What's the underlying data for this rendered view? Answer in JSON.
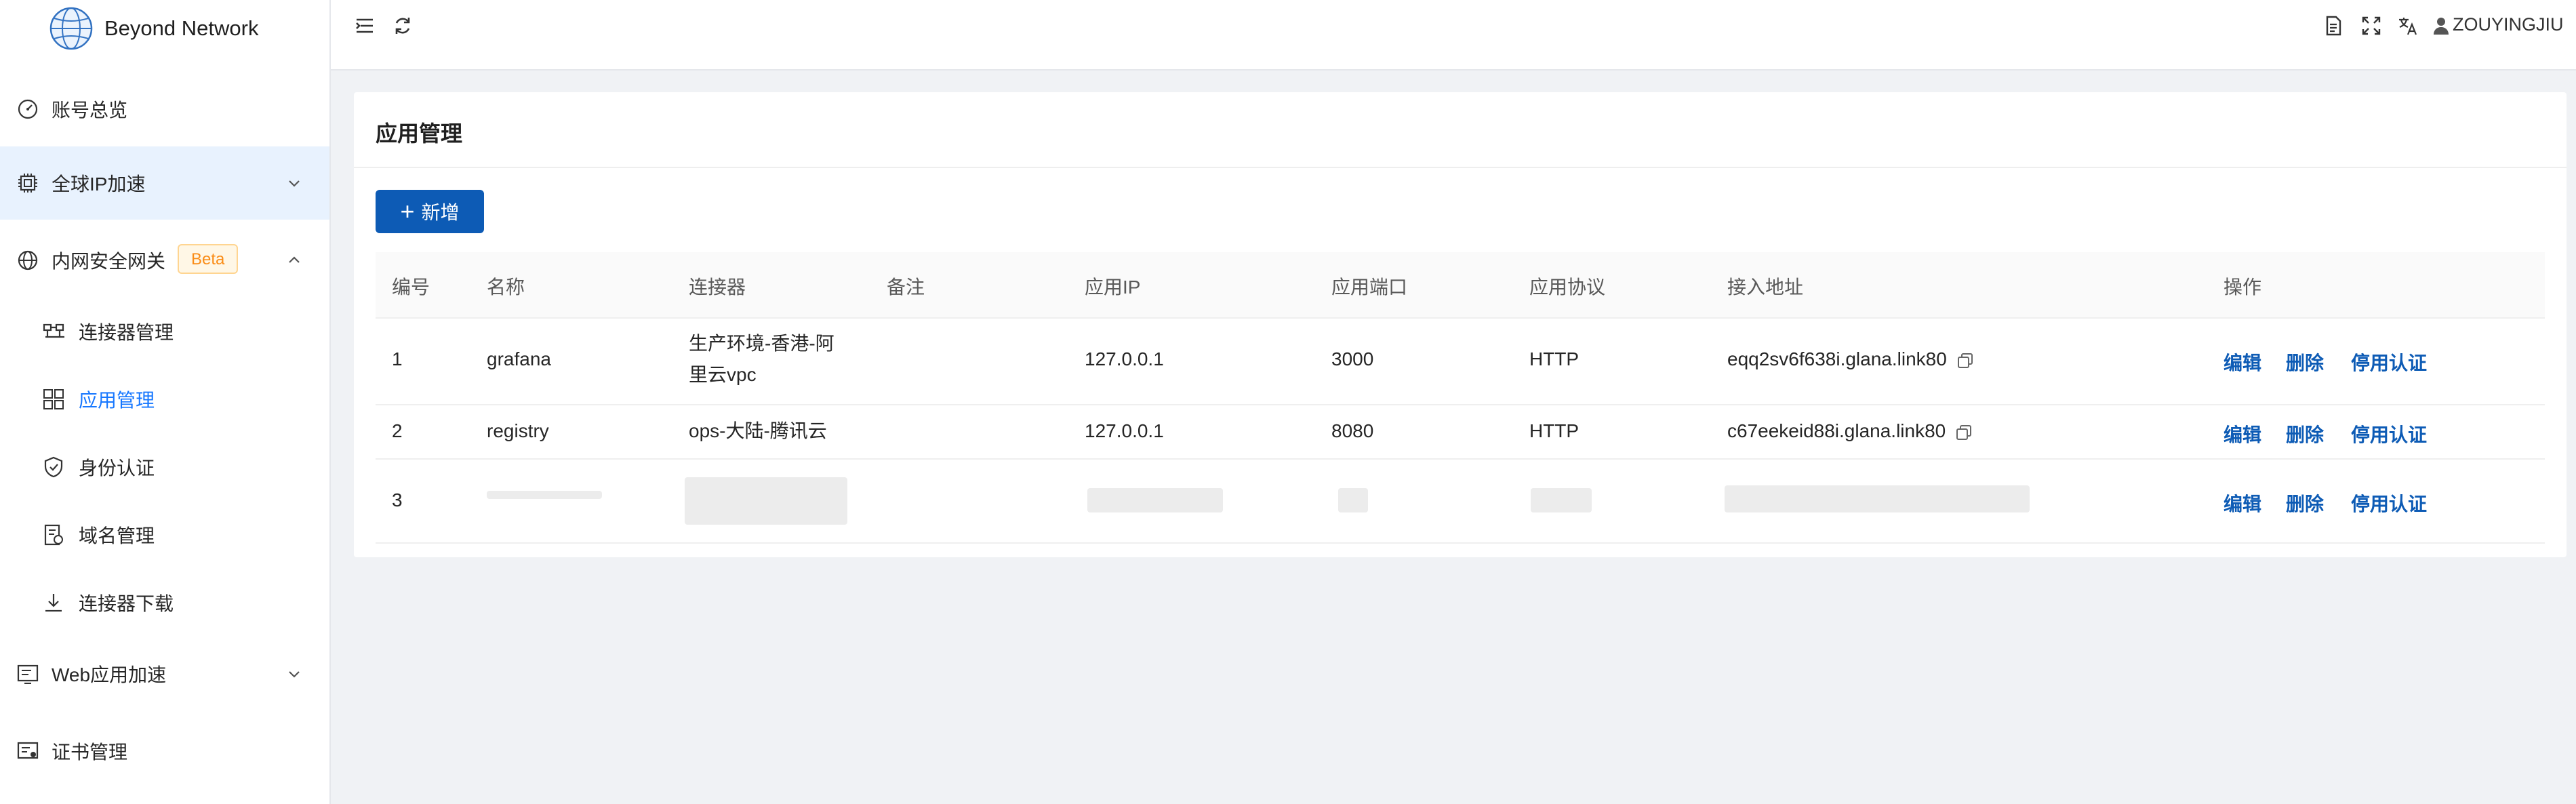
{
  "app": {
    "name": "Beyond Network"
  },
  "sidebar": {
    "items": [
      {
        "label": "账号总览",
        "icon": "dashboard-icon"
      },
      {
        "label": "全球IP加速",
        "icon": "chip-icon"
      },
      {
        "label": "内网安全网关",
        "icon": "globe-gear-icon",
        "badge": "Beta"
      },
      {
        "label": "Web应用加速",
        "icon": "web-icon"
      },
      {
        "label": "证书管理",
        "icon": "certificate-icon"
      }
    ],
    "sub_items": [
      {
        "label": "连接器管理",
        "icon": "connector-icon"
      },
      {
        "label": "应用管理",
        "icon": "apps-icon"
      },
      {
        "label": "身份认证",
        "icon": "shield-icon"
      },
      {
        "label": "域名管理",
        "icon": "domain-icon"
      },
      {
        "label": "连接器下载",
        "icon": "download-icon"
      }
    ]
  },
  "topbar": {
    "user": "ZOUYINGJIU"
  },
  "page": {
    "title": "应用管理",
    "add_label": "新增"
  },
  "table": {
    "headers": [
      "编号",
      "名称",
      "连接器",
      "备注",
      "应用IP",
      "应用端口",
      "应用协议",
      "接入地址",
      "操作"
    ],
    "rows": [
      {
        "id": "1",
        "name": "grafana",
        "connector_line1": "生产环境-香港-阿",
        "connector_line2": "里云vpc",
        "note": "",
        "ip": "127.0.0.1",
        "port": "3000",
        "protocol": "HTTP",
        "address": "eqq2sv6f638i.glana.link80"
      },
      {
        "id": "2",
        "name": "registry",
        "connector_line1": "ops-大陆-腾讯云",
        "connector_line2": "",
        "note": "",
        "ip": "127.0.0.1",
        "port": "8080",
        "protocol": "HTTP",
        "address": "c67eekeid88i.glana.link80"
      },
      {
        "id": "3"
      }
    ],
    "actions": {
      "edit": "编辑",
      "delete": "删除",
      "disable_auth": "停用认证"
    }
  },
  "colors": {
    "primary": "#0d5bb5",
    "active_menu_bg": "#e8f2fe",
    "beta": "#fa8c16"
  }
}
